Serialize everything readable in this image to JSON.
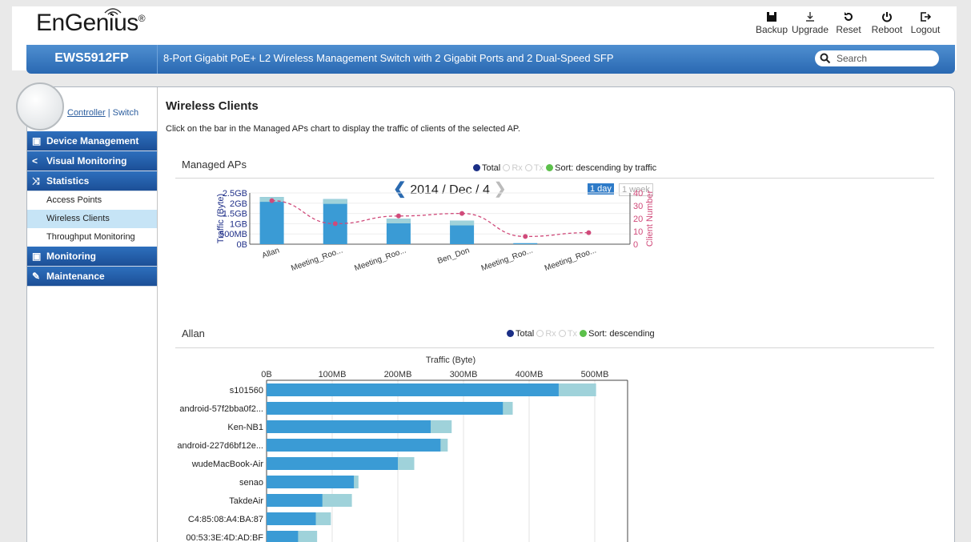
{
  "brand": {
    "logo": "EnGenius",
    "reg": "®"
  },
  "toolbar": {
    "backup": "Backup",
    "upgrade": "Upgrade",
    "reset": "Reset",
    "reboot": "Reboot",
    "logout": "Logout"
  },
  "header": {
    "model": "EWS5912FP",
    "description": "8-Port Gigabit PoE+ L2 Wireless Management Switch with 2 Gigabit Ports and 2 Dual-Speed SFP",
    "search_placeholder": "Search"
  },
  "sidebar": {
    "controller": "Controller",
    "separator": "|",
    "switch": "Switch",
    "menu": [
      {
        "label": "Device Management",
        "icon": "device-icon"
      },
      {
        "label": "Visual Monitoring",
        "icon": "share-icon"
      },
      {
        "label": "Statistics",
        "icon": "shuffle-icon"
      },
      {
        "label": "Access Points"
      },
      {
        "label": "Wireless Clients",
        "active": true
      },
      {
        "label": "Throughput Monitoring"
      },
      {
        "label": "Monitoring",
        "icon": "monitor-icon"
      },
      {
        "label": "Maintenance",
        "icon": "wrench-icon"
      }
    ]
  },
  "main": {
    "title": "Wireless Clients",
    "subtitle": "Click on the bar in the Managed APs chart to display the traffic of clients of the selected AP.",
    "managed": {
      "label": "Managed APs",
      "legend": {
        "total": "Total",
        "rx": "Rx",
        "tx": "Tx",
        "sort": "Sort: descending by traffic"
      },
      "date": "2014 / Dec / 4",
      "day": "1 day",
      "week": "1 week"
    },
    "allan": {
      "label": "Allan",
      "legend": {
        "total": "Total",
        "rx": "Rx",
        "tx": "Tx",
        "sort": "Sort: descending"
      }
    }
  },
  "colors": {
    "bar": "#3a9bd5",
    "bar_light": "#9fd2da",
    "line": "#d04a7a",
    "nav": "#1f5fa8"
  },
  "chart_data": [
    {
      "type": "bar",
      "title": "",
      "xlabel": "",
      "ylabel": "Traffic (Byte)",
      "y2label": "Client Number",
      "categories": [
        "Allan",
        "Meeting_Roo...",
        "Meeting_Roo...",
        "Ben_Don",
        "Meeting_Roo...",
        "Meeting_Roo..."
      ],
      "yticks": [
        "2.5GB",
        "2GB",
        "1.5GB",
        "1GB",
        "500MB",
        "0B"
      ],
      "y2ticks": [
        "40",
        "30",
        "20",
        "10",
        "0"
      ],
      "ylim": [
        0,
        2.5
      ],
      "y2lim": [
        0,
        40
      ],
      "series": [
        {
          "values": [
            2.3,
            2.2,
            1.25,
            1.15,
            0.05,
            0.0
          ]
        },
        {
          "values": [
            34,
            16,
            22,
            24,
            6,
            9
          ]
        }
      ]
    },
    {
      "type": "bar",
      "orientation": "horizontal",
      "title": "",
      "xlabel": "Traffic (Byte)",
      "xticks": [
        "0B",
        "100MB",
        "200MB",
        "300MB",
        "400MB",
        "500MB"
      ],
      "xlim": [
        0,
        550
      ],
      "categories": [
        "s101560",
        "android-57f2bba0f2...",
        "Ken-NB1",
        "android-227d6bf12e...",
        "wudeMacBook-Air",
        "senao",
        "TakdeAir",
        "C4:85:08:A4:BA:87",
        "00:53:3E:4D:AD:BF"
      ],
      "series": [
        {
          "values": [
            445,
            360,
            250,
            265,
            200,
            133,
            85,
            75,
            48
          ]
        },
        {
          "values": [
            502,
            375,
            282,
            276,
            225,
            140,
            130,
            98,
            77
          ]
        }
      ]
    }
  ]
}
